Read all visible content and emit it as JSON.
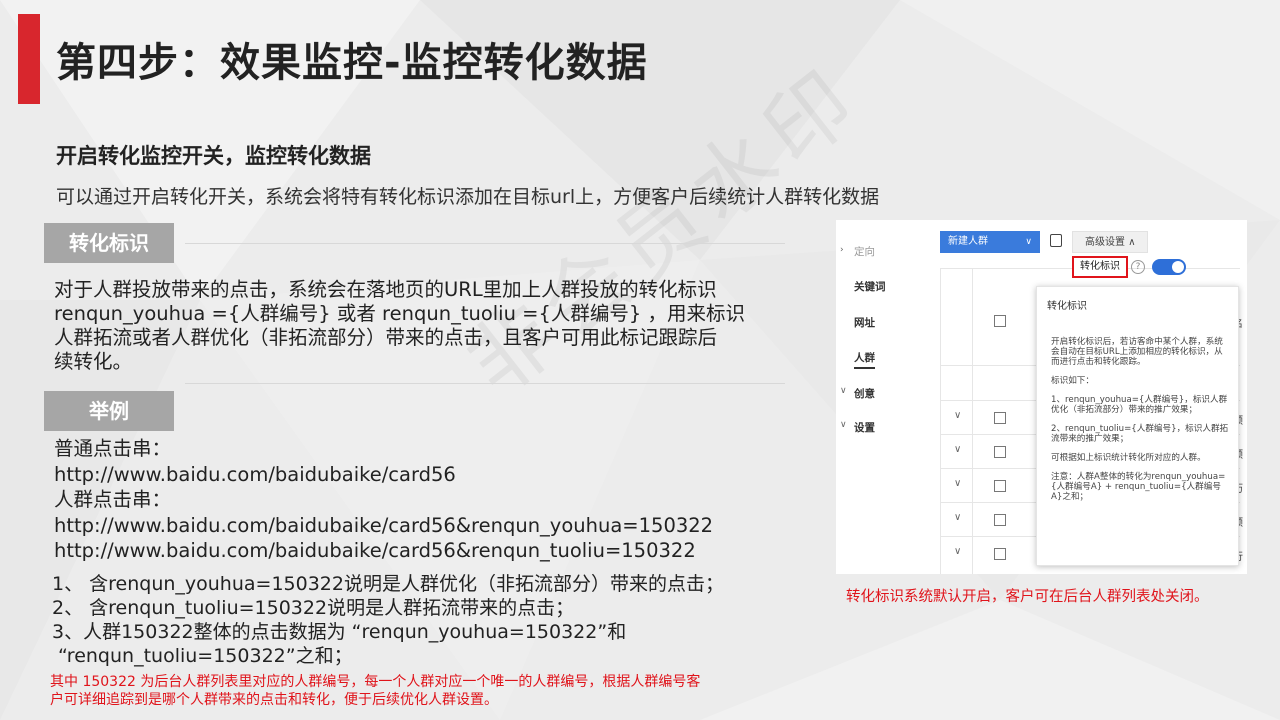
{
  "title": "第四步：效果监控-监控转化数据",
  "watermark": "非会员水印",
  "subtitle": "开启转化监控开关，监控转化数据",
  "intro": "可以通过开启转化开关，系统会将特有转化标识添加在目标url上，方便客户后续统计人群转化数据",
  "tags": {
    "conversion_mark": "转化标识",
    "example": "举例"
  },
  "paragraph": [
    "对于人群投放带来的点击，系统会在落地页的URL里加上人群投放的转化标识",
    "renqun_youhua ={人群编号} 或者 renqun_tuoliu ={人群编号} ，用来标识",
    "人群拓流或者人群优化（非拓流部分）带来的点击，且客户可用此标记跟踪后",
    "续转化。"
  ],
  "examples": [
    "普通点击串：",
    "http://www.baidu.com/baidubaike/card56",
    "人群点击串：",
    "http://www.baidu.com/baidubaike/card56&renqun_youhua=150322",
    "http://www.baidu.com/baidubaike/card56&renqun_tuoliu=150322"
  ],
  "notes": [
    "1、 含renqun_youhua=150322说明是人群优化（非拓流部分）带来的点击；",
    "2、 含renqun_tuoliu=150322说明是人群拓流带来的点击；",
    "3、人群150322整体的点击数据为 “renqun_youhua=150322”和",
    "“renqun_tuoliu=150322”之和；"
  ],
  "footnote": [
    "其中 150322 为后台人群列表里对应的人群编号，每一个人群对应一个唯一的人群编号，根据人群编号客",
    "户可详细追踪到是哪个人群带来的点击和转化，便于后续优化人群设置。"
  ],
  "screenshot": {
    "sidebar": {
      "targeting": "定向",
      "keywords": "关键词",
      "website": "网址",
      "audience": "人群",
      "creative": "创意",
      "settings": "设置"
    },
    "new_audience_button": "新建人群",
    "advanced_settings": "高级设置",
    "conversion_mark_label": "转化标识",
    "help_icon": "?",
    "toggle_on": true,
    "popover": {
      "title": "转化标识",
      "p1": "开启转化标识后，若访客命中某个人群，系统会自动在目标URL上添加相应的转化标识，从而进行点击和转化跟踪。",
      "p2": "标识如下：",
      "p3": "1、renqun_youhua={人群编号}，标识人群优化（非拓流部分）带来的推广效果；",
      "p4": "2、renqun_tuoliu={人群编号}，标识人群拓流带来的推广效果；",
      "p5": "可根据如上标识统计转化所对应的人群。",
      "p6": "注意：人群A整体的转化为renqun_youhua={人群编号A} + renqun_tuoliu={人群编号A}之和；"
    },
    "clipped_col_top": "名",
    "clipped_rows": [
      "预",
      "预",
      "历",
      "预",
      "行"
    ]
  },
  "caption": "转化标识系统默认开启，客户可在后台人群列表处关闭。",
  "colors": {
    "accent_red": "#d8262d",
    "note_red": "#e0141b",
    "tag_gray": "#a6a6a6",
    "primary_blue": "#3a7bdc"
  }
}
